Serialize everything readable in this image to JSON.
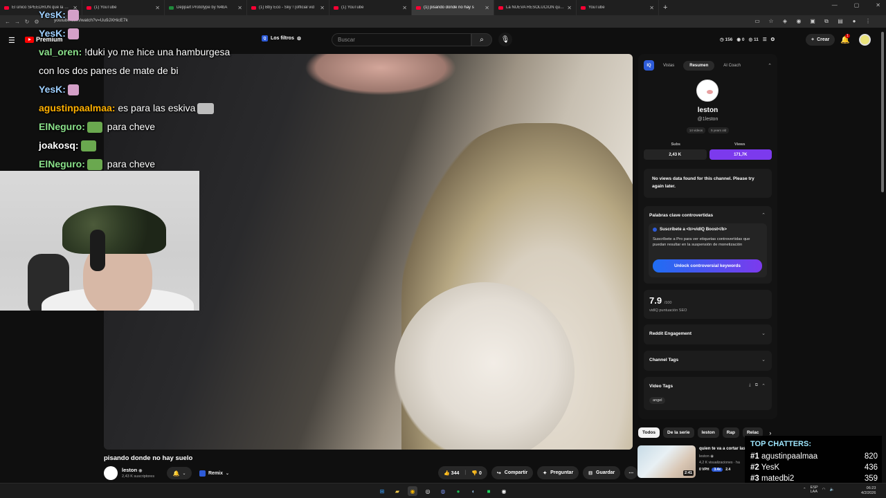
{
  "browser": {
    "tabs": [
      {
        "title": "El único SPEEDRUN que la hum",
        "icon": "youtube-icon",
        "active": false
      },
      {
        "title": "(1) YouTube",
        "icon": "youtube-icon",
        "active": false
      },
      {
        "title": "Deppart Prototype by N4bA",
        "icon": "itch-icon",
        "active": false
      },
      {
        "title": "(1) Bby Eco - Sky ! (official vid",
        "icon": "youtube-icon",
        "active": false
      },
      {
        "title": "(1) YouTube",
        "icon": "youtube-icon",
        "active": false
      },
      {
        "title": "(1) pisando donde no hay s",
        "icon": "youtube-icon",
        "active": true
      },
      {
        "title": "La NUEVA RESOLUCIÓN que t",
        "icon": "youtube-icon",
        "active": false
      },
      {
        "title": "YouTube",
        "icon": "youtube-icon",
        "active": false
      }
    ],
    "url": "youtube.com/watch?v=Uu9JXHicE7k"
  },
  "header": {
    "logo_text": "Premium",
    "filters_label": "Los filtros",
    "search_placeholder": "Buscar",
    "stats": [
      "156",
      "0",
      "11"
    ],
    "create_label": "Crear",
    "notif_count": "1"
  },
  "overlay_chat": [
    {
      "user": "YesK:",
      "message": "",
      "color": "yesk"
    },
    {
      "user": "YesK:",
      "message": "",
      "color": "yesk"
    },
    {
      "user": "val_oren:",
      "message": " !duki yo me hice una hamburgesa",
      "color": "val"
    },
    {
      "user": "",
      "message": "con los dos panes de mate de bi",
      "color": "plain"
    },
    {
      "user": "YesK:",
      "message": "",
      "color": "yesk"
    },
    {
      "user": "agustinpaalmaa:",
      "message": " es para las eskiva",
      "color": "agus"
    },
    {
      "user": "ElNeguro:",
      "message": " para cheve",
      "color": "neg"
    },
    {
      "user": "joakosq:",
      "message": "",
      "color": "joak"
    },
    {
      "user": "ElNeguro:",
      "message": " para cheve",
      "color": "neg"
    }
  ],
  "video": {
    "title": "pisando donde no hay suelo",
    "channel": "leston",
    "subscribers": "2,43 K suscriptores",
    "remix_label": "Remix",
    "likes": "344",
    "dislikes": "0",
    "share_label": "Compartir",
    "ask_label": "Preguntar",
    "save_label": "Guardar"
  },
  "vidiq": {
    "logo": "IQ",
    "tabs": [
      "Vistas",
      "Resumen",
      "AI Coach"
    ],
    "channel_name": "leston",
    "channel_handle": "@1leston",
    "videos_count": "14 videos",
    "channel_age": "5 years old",
    "subs_label": "Subs",
    "views_label": "Views",
    "subs_value": "2,43 K",
    "views_value": "171,7K",
    "no_data_text": "No views data found for this channel. Please try again later.",
    "keywords_header": "Palabras clave controvertidas",
    "pro_title": "Suscríbete a <b>vidIQ Boost</b>",
    "pro_desc": "Suscríbete a Pro para ver etiquetas controvertidas que puedan resultar en la suspensión de monetización",
    "unlock_label": "Unlock controversial keywords",
    "seo_score": "7.9",
    "seo_max": "/100",
    "seo_label": "vidIQ puntuación SEO",
    "reddit_label": "Reddit Engagement",
    "channel_tags_label": "Channel Tags",
    "video_tags_label": "Video Tags",
    "video_tag": "angel"
  },
  "related": {
    "chips": [
      "Todos",
      "De la serie",
      "leston",
      "Rap",
      "Relac"
    ],
    "item": {
      "title": "quien te va a cortar las",
      "channel": "leston",
      "views": "4,2 K visualizaciones · ha",
      "vph": "0 VPH",
      "pill": "3.4x",
      "extra": "2.4",
      "duration": "2:41"
    }
  },
  "top_chatters": {
    "title": "TOP CHATTERS:",
    "rows": [
      {
        "rank": "#1",
        "name": "agustinpaalmaa",
        "count": "820"
      },
      {
        "rank": "#2",
        "name": "YesK",
        "count": "436"
      },
      {
        "rank": "#3",
        "name": "matedbi2",
        "count": "359"
      }
    ]
  },
  "taskbar": {
    "lang": "LAA",
    "lang2": "ESP",
    "time": "06:23",
    "date": "4/2/2026"
  },
  "colors": {
    "accent_red": "#ff0000",
    "vidiq_blue": "#2d5bd8",
    "vidiq_purple": "#7c3aed"
  }
}
